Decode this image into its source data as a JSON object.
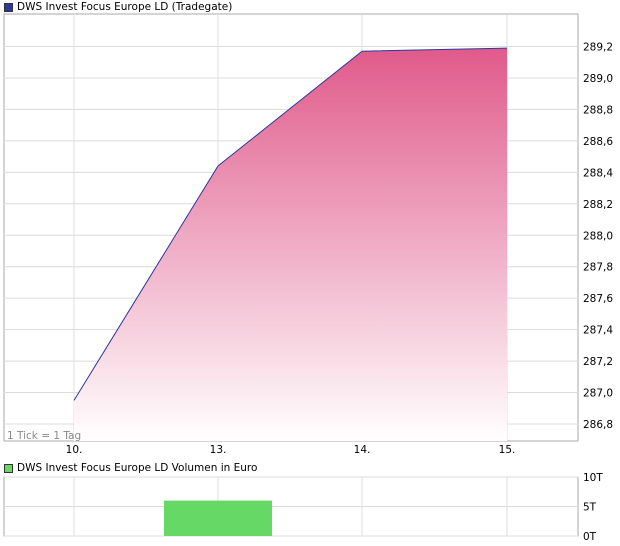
{
  "chart_data": [
    {
      "type": "area",
      "title": "DWS Invest Focus Europe LD (Tradegate)",
      "legend_color": "#2b3a9a",
      "line_color": "#2b3a9a",
      "fill_top_color": "#e05a8a",
      "fill_bottom_color": "#ffffff",
      "x_labels": [
        "10.",
        "13.",
        "14.",
        "15."
      ],
      "x": [
        "10.",
        "13.",
        "14.",
        "15."
      ],
      "y": [
        286.95,
        288.44,
        289.17,
        289.19
      ],
      "ylim": [
        286.7,
        289.35
      ],
      "y_ticks": [
        286.8,
        287.0,
        287.2,
        287.4,
        287.6,
        287.8,
        288.0,
        288.2,
        288.4,
        288.6,
        288.8,
        289.0,
        289.2
      ],
      "y_tick_labels": [
        "286,8",
        "287,0",
        "287,2",
        "287,4",
        "287,6",
        "287,8",
        "288,0",
        "288,2",
        "288,4",
        "288,6",
        "288,8",
        "289,0",
        "289,2"
      ],
      "y_axis_position": "right",
      "grid": true,
      "note": "1 Tick = 1 Tag"
    },
    {
      "type": "bar",
      "title": "DWS Invest Focus Europe LD Volumen in Euro",
      "legend_color": "#66d866",
      "bar_color": "#66d866",
      "categories": [
        "10.",
        "13.",
        "14.",
        "15."
      ],
      "values": [
        0,
        6000,
        0,
        0
      ],
      "ylim": [
        0,
        10000
      ],
      "y_ticks": [
        0,
        5000,
        10000
      ],
      "y_tick_labels": [
        "0T",
        "5T",
        "10T"
      ],
      "y_axis_position": "right",
      "grid": true
    }
  ]
}
